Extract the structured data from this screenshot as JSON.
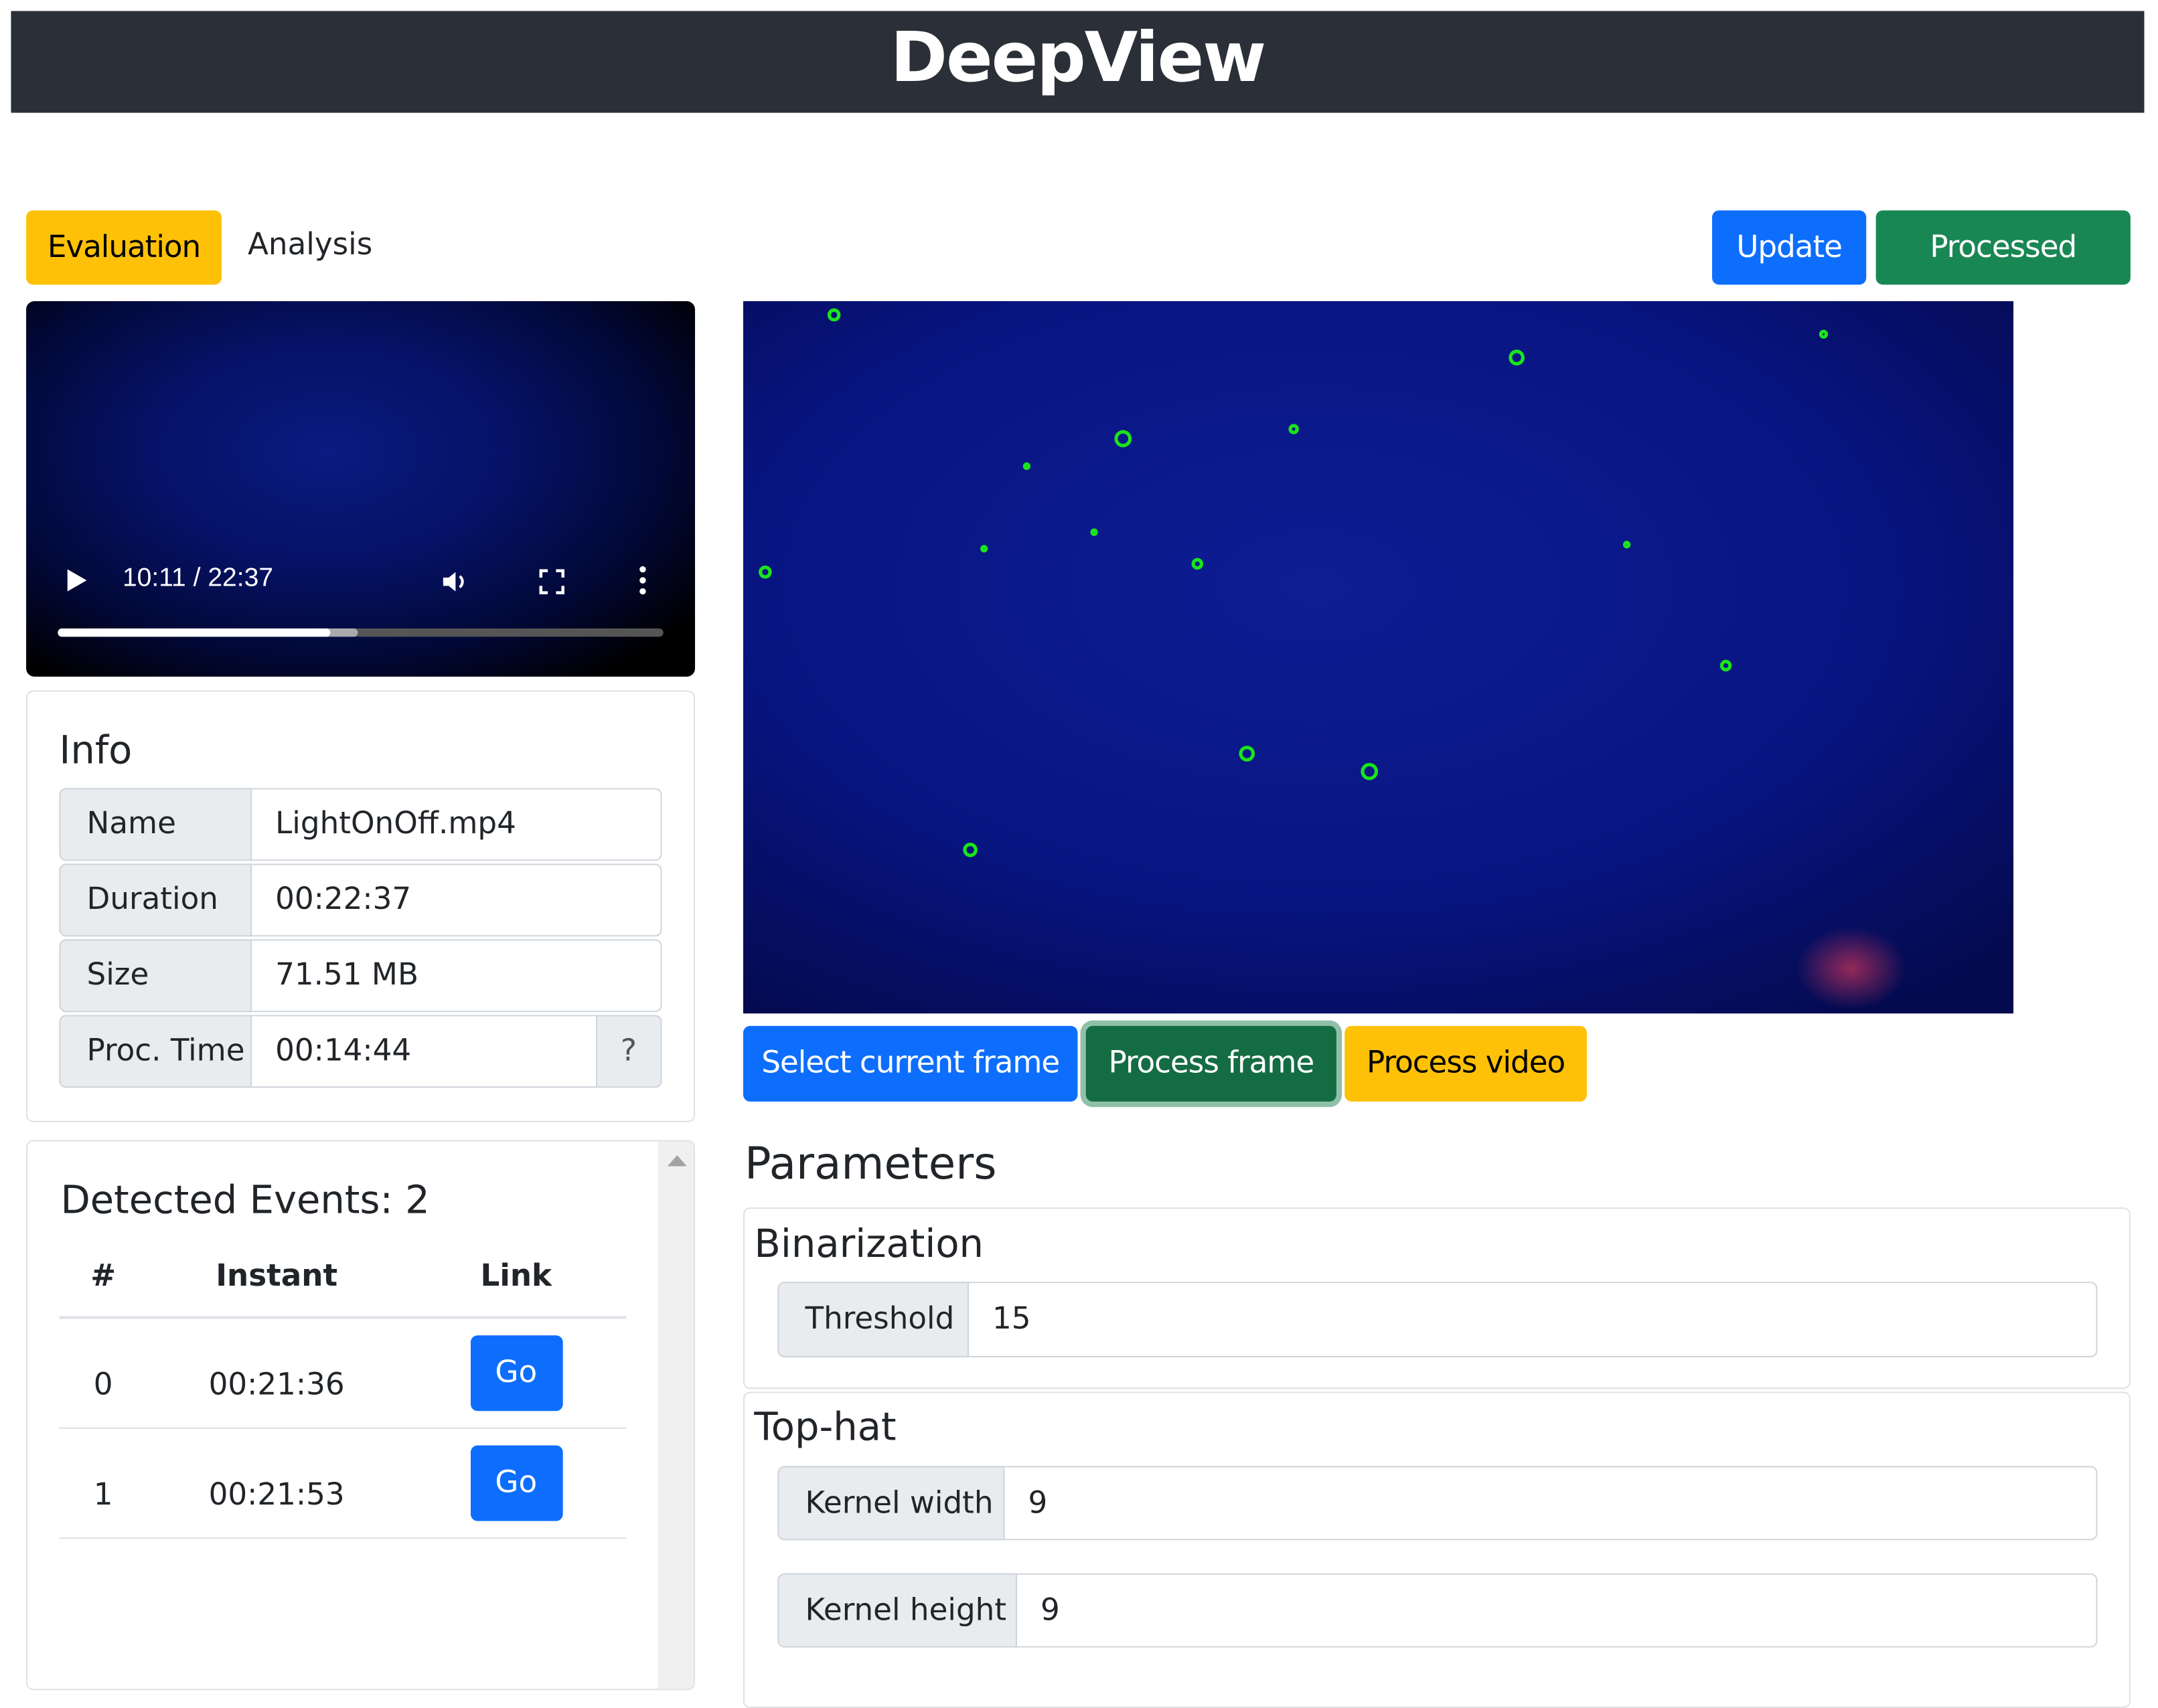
{
  "app": {
    "title": "DeepView"
  },
  "tabs": [
    {
      "label": "Evaluation",
      "active": true
    },
    {
      "label": "Analysis",
      "active": false
    }
  ],
  "toolbar": {
    "update_label": "Update",
    "processed_label": "Processed"
  },
  "video": {
    "time": "10:11 / 22:37",
    "progress": 0.45,
    "buffered": 0.495
  },
  "info": {
    "title": "Info",
    "rows": [
      {
        "label": "Name",
        "value": "LightOnOff.mp4"
      },
      {
        "label": "Duration",
        "value": "00:22:37"
      },
      {
        "label": "Size",
        "value": "71.51 MB"
      },
      {
        "label": "Proc. Time",
        "value": "00:14:44",
        "help": "?"
      }
    ]
  },
  "events": {
    "title": "Detected Events: 2",
    "columns": [
      "#",
      "Instant",
      "Link"
    ],
    "rows": [
      {
        "index": "0",
        "instant": "00:21:36",
        "link": "Go"
      },
      {
        "index": "1",
        "instant": "00:21:53",
        "link": "Go"
      }
    ]
  },
  "frame_actions": {
    "select": "Select current frame",
    "process_frame": "Process frame",
    "process_video": "Process video"
  },
  "parameters": {
    "title": "Parameters",
    "binarization": {
      "title": "Binarization",
      "threshold_label": "Threshold",
      "threshold": "15"
    },
    "tophat": {
      "title": "Top-hat",
      "kw_label": "Kernel width",
      "kw": "9",
      "kh_label": "Kernel height",
      "kh": "9"
    }
  },
  "colors": {
    "primary": "#0d6efd",
    "success": "#198754",
    "warning": "#ffc107",
    "header": "#2b2f37",
    "marker": "#19e619"
  }
}
